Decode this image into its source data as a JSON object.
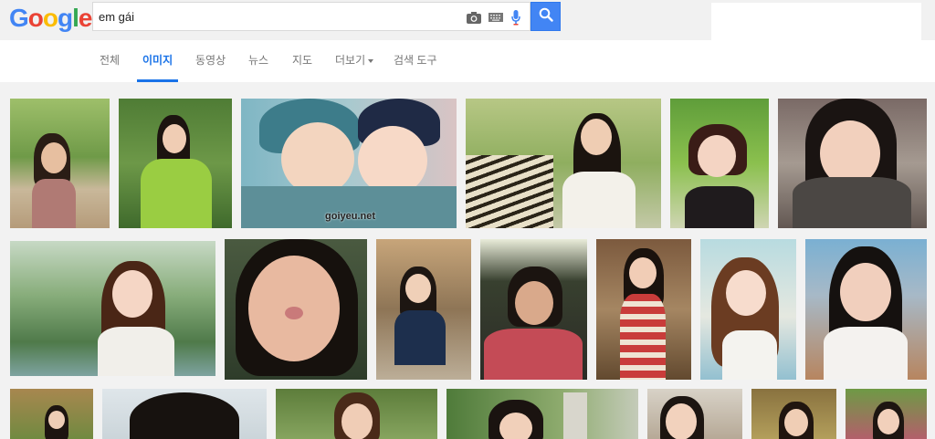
{
  "logo": {
    "text": "Google",
    "letters": [
      "G",
      "o",
      "o",
      "g",
      "l",
      "e"
    ]
  },
  "search": {
    "query": "em gái"
  },
  "icons": {
    "camera": "camera-icon",
    "keyboard": "keyboard-icon",
    "mic": "microphone-icon",
    "search": "search-icon"
  },
  "colors": {
    "accent": "#1a73e8",
    "search_button": "#4285f4"
  },
  "tabs": [
    {
      "label": "전체",
      "active": false
    },
    {
      "label": "이미지",
      "active": true
    },
    {
      "label": "동영상",
      "active": false
    },
    {
      "label": "뉴스",
      "active": false
    },
    {
      "label": "지도",
      "active": false
    },
    {
      "label": "더보기",
      "active": false,
      "dropdown": true
    },
    {
      "label": "검색 도구",
      "active": false
    }
  ],
  "results": {
    "watermark": "goiyeu.net"
  }
}
